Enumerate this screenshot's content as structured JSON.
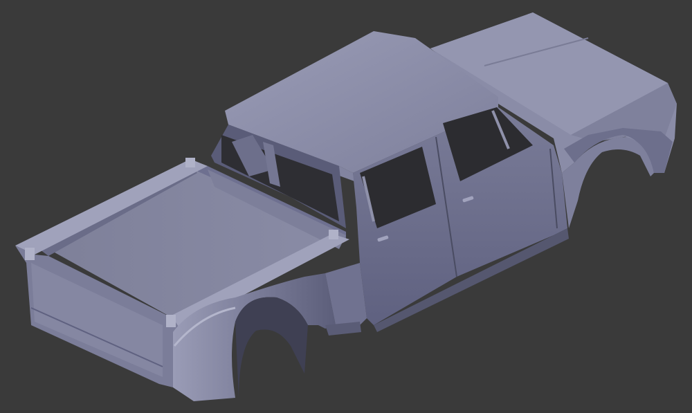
{
  "viewport": {
    "background_color": "#3a3a3a"
  },
  "model": {
    "subject": "pickup-truck-body-3d-render",
    "shading": "matcap",
    "colors": {
      "body_light": "#8c8ea9",
      "body_mid": "#6f7190",
      "body_dark": "#4f5169",
      "shadow": "#3c3d50",
      "highlight": "#a4a6c0",
      "glass_dark": "#2c2c30"
    }
  }
}
